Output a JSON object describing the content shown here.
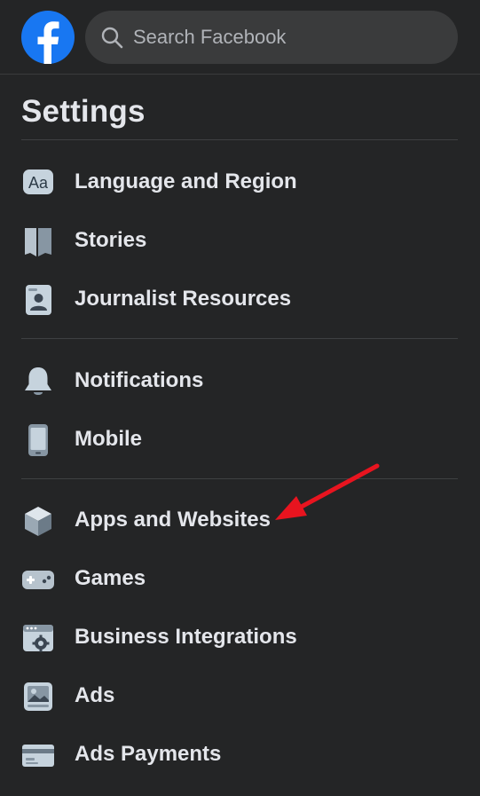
{
  "header": {
    "search_placeholder": "Search Facebook",
    "logo_color": "#1877f2"
  },
  "page_title": "Settings",
  "colors": {
    "background": "#242526",
    "search_bg": "#3a3b3c",
    "text": "#e4e6eb",
    "annotation_arrow": "#e8141f"
  },
  "sections": [
    {
      "items": [
        {
          "label": "Language and Region",
          "icon": "language-icon"
        },
        {
          "label": "Stories",
          "icon": "stories-book-icon"
        },
        {
          "label": "Journalist Resources",
          "icon": "journalist-badge-icon"
        }
      ]
    },
    {
      "items": [
        {
          "label": "Notifications",
          "icon": "bell-icon"
        },
        {
          "label": "Mobile",
          "icon": "mobile-phone-icon"
        }
      ]
    },
    {
      "items": [
        {
          "label": "Apps and Websites",
          "icon": "cube-icon"
        },
        {
          "label": "Games",
          "icon": "gamepad-icon"
        },
        {
          "label": "Business Integrations",
          "icon": "business-integrations-icon"
        },
        {
          "label": "Ads",
          "icon": "ads-image-icon"
        },
        {
          "label": "Ads Payments",
          "icon": "credit-card-icon"
        }
      ]
    }
  ]
}
